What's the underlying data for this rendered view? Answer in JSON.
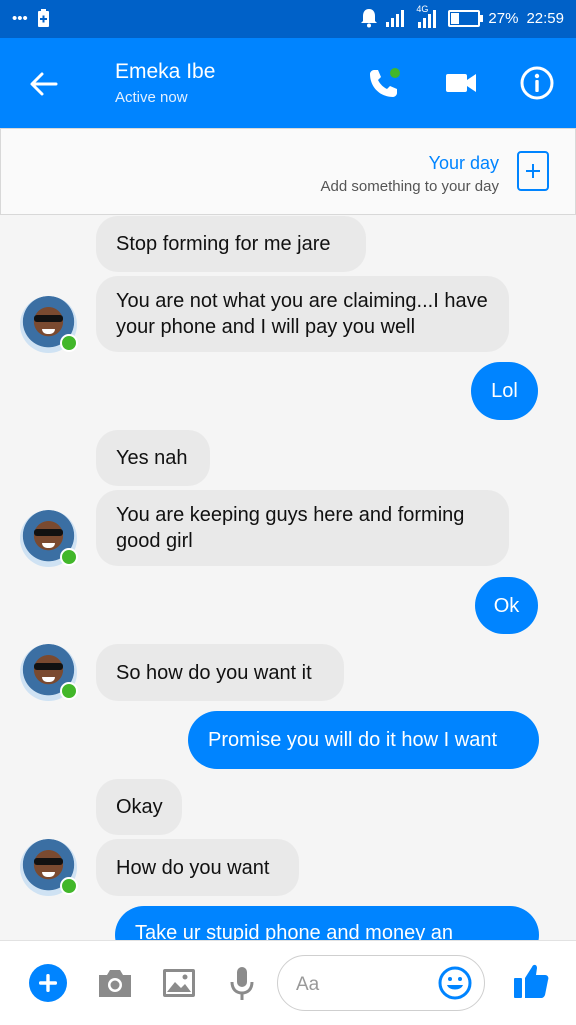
{
  "statusbar": {
    "network_label": "4G",
    "battery_percent": 27,
    "battery_text": "27%",
    "time": "22:59"
  },
  "header": {
    "name": "Emeka Ibe",
    "status": "Active now",
    "icons": [
      "back-arrow-icon",
      "phone-call-icon",
      "video-call-icon",
      "info-icon"
    ]
  },
  "your_day": {
    "title": "Your day",
    "subtitle": "Add something to your day"
  },
  "messages": [
    {
      "side": "in",
      "text": "Stop forming for me jare"
    },
    {
      "side": "in",
      "text": "You are not what you are claiming...I have your phone and I will pay you well"
    },
    {
      "side": "out",
      "text": "Lol"
    },
    {
      "side": "in",
      "text": "Yes nah"
    },
    {
      "side": "in",
      "text": "You are keeping guys here and forming good girl"
    },
    {
      "side": "out",
      "text": "Ok"
    },
    {
      "side": "in",
      "text": "So how do you want it"
    },
    {
      "side": "out",
      "text": "Promise you will do it how I want"
    },
    {
      "side": "in",
      "text": "Okay"
    },
    {
      "side": "in",
      "text": "How do you want"
    },
    {
      "side": "out",
      "text": "Take ur stupid phone and money an"
    }
  ],
  "composer": {
    "placeholder": "Aa",
    "icons": [
      "plus-icon",
      "camera-icon",
      "image-icon",
      "microphone-icon",
      "emoji-icon",
      "thumbs-up-icon"
    ]
  },
  "colors": {
    "accent": "#0084ff",
    "statusbar": "#0061c8",
    "incoming_bubble": "#e9e9e9",
    "online": "#42b72a"
  }
}
